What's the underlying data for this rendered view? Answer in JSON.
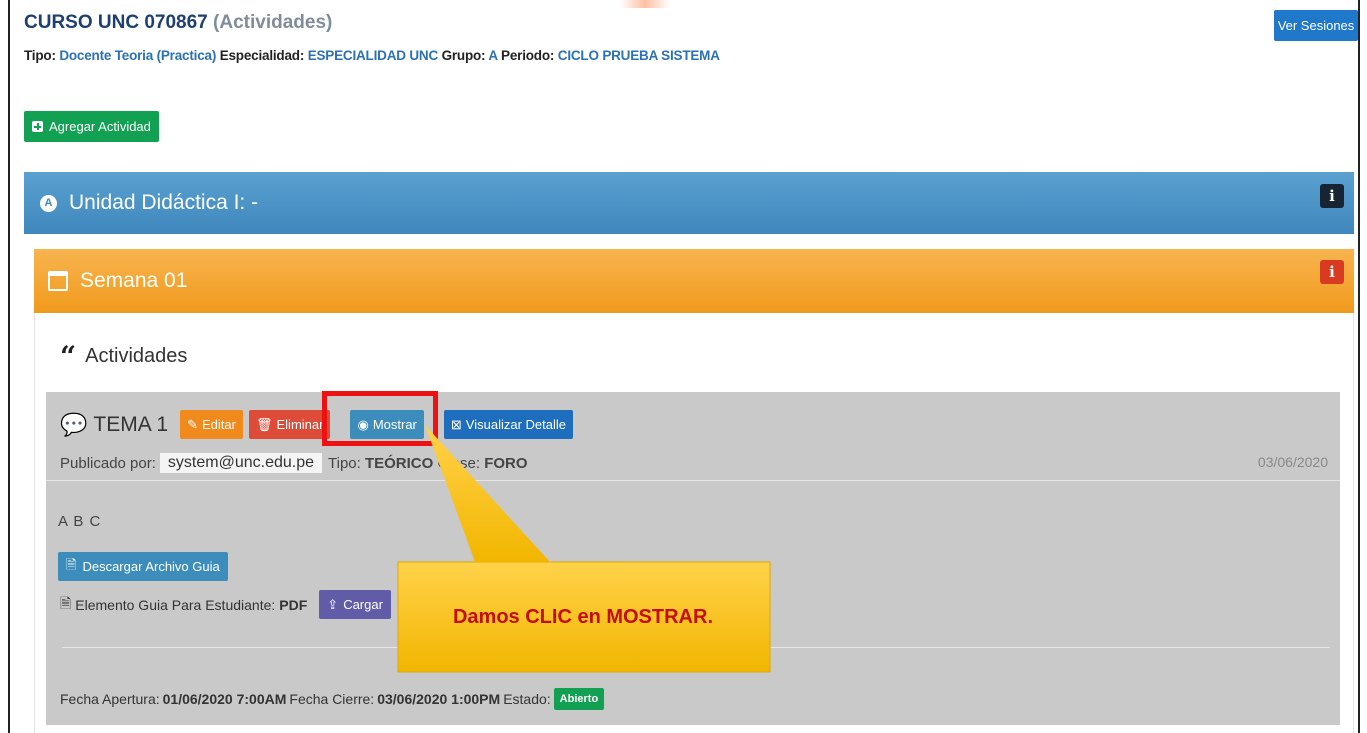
{
  "header": {
    "course": "CURSO UNC 070867",
    "section": "(Actividades)",
    "tipo_label": "Tipo:",
    "tipo_value": "Docente Teoria (Practica)",
    "especialidad_label": "Especialidad:",
    "especialidad_value": "ESPECIALIDAD UNC",
    "grupo_label": "Grupo:",
    "grupo_value": "A",
    "periodo_label": "Periodo:",
    "periodo_value": "CICLO PRUEBA SISTEMA",
    "ver_sesiones": "Ver Sesiones"
  },
  "toolbar": {
    "agregar_label": "Agregar Actividad"
  },
  "unit": {
    "label": "A",
    "title": "Unidad Didáctica I: -",
    "info": "i"
  },
  "week": {
    "title": "Semana 01",
    "info": "i"
  },
  "activities": {
    "heading": "Actividades",
    "item": {
      "title": "TEMA 1",
      "editar": "Editar",
      "eliminar": "Eliminar",
      "mostrar": "Mostrar",
      "visualizar": "Visualizar Detalle",
      "publicado_label": "Publicado por:",
      "publisher": "system@unc.edu.pe",
      "tipo_label": "Tipo:",
      "tipo_value": "TEÓRICO",
      "clase_label": "Clase:",
      "clase_value": "FORO",
      "date": "03/06/2020",
      "description": "A B C",
      "descargar": "Descargar Archivo Guia",
      "elemento_label": "Elemento Guia Para Estudiante:",
      "elemento_value": "PDF",
      "cargar": "Cargar",
      "apertura_label": "Fecha Apertura:",
      "apertura_value": "01/06/2020 7:00AM",
      "cierre_label": "Fecha Cierre:",
      "cierre_value": "03/06/2020 1:00PM",
      "estado_label": "Estado:",
      "estado_value": "Abierto"
    }
  },
  "callout": {
    "text": "Damos CLIC en MOSTRAR."
  },
  "colors": {
    "primary": "#3c8dbc",
    "success": "#12a152",
    "warning": "#f18a1c",
    "danger": "#dd4b39",
    "callout": "#f8c400",
    "highlight": "#ee1111"
  }
}
